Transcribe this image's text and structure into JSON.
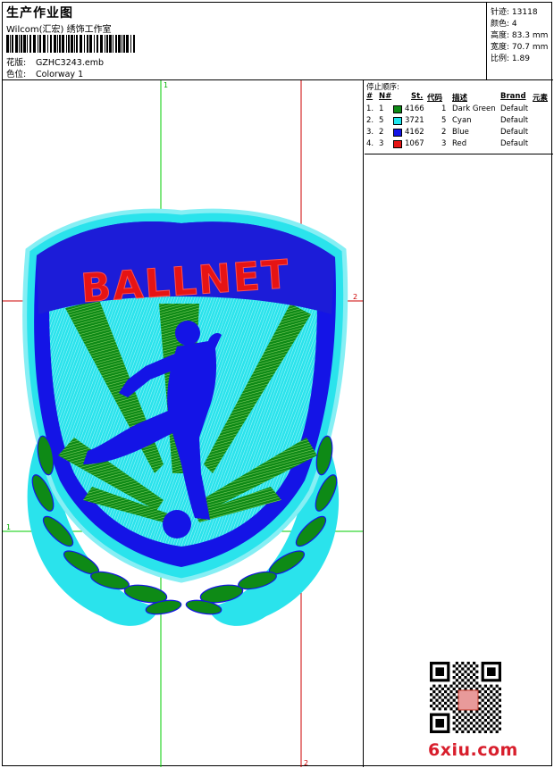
{
  "header": {
    "title": "生产作业图",
    "studio": "Wilcom(汇宏) 绣饰工作室",
    "design_label": "花版:",
    "design_file": "GZHC3243.emb",
    "colorway_label": "色位:",
    "colorway": "Colorway 1"
  },
  "stats": [
    {
      "label": "针迹:",
      "value": "13118"
    },
    {
      "label": "颜色:",
      "value": "4"
    },
    {
      "label": "高度:",
      "value": "83.3 mm"
    },
    {
      "label": "宽度:",
      "value": "70.7 mm"
    },
    {
      "label": "比例:",
      "value": "1.89"
    }
  ],
  "stop_sequence": {
    "title": "停止顺序:",
    "columns": [
      "#",
      "N#",
      "St.",
      "代码",
      "描述",
      "Brand",
      "元素"
    ],
    "rows": [
      {
        "idx": "1.",
        "n": "1",
        "code": "4166",
        "st": "1",
        "desc": "Dark Green",
        "brand": "Default",
        "color": "#0e8a16"
      },
      {
        "idx": "2.",
        "n": "5",
        "code": "3721",
        "st": "5",
        "desc": "Cyan",
        "brand": "Default",
        "color": "#1ee6ee"
      },
      {
        "idx": "3.",
        "n": "2",
        "code": "4162",
        "st": "2",
        "desc": "Blue",
        "brand": "Default",
        "color": "#1414e6"
      },
      {
        "idx": "4.",
        "n": "3",
        "code": "1067",
        "st": "3",
        "desc": "Red",
        "brand": "Default",
        "color": "#e61414"
      }
    ]
  },
  "design": {
    "logo_text": "BALLNET",
    "guide_labels": {
      "top": "1",
      "right": "2",
      "left": "1",
      "bottom": "2"
    },
    "colors": {
      "green": "#0e8a16",
      "cyan": "#1ee6ee",
      "blue": "#1414e6",
      "red": "#e61414",
      "guide_green": "#00cc00",
      "guide_red": "#cc0000"
    }
  },
  "watermark": "6xiu.com"
}
